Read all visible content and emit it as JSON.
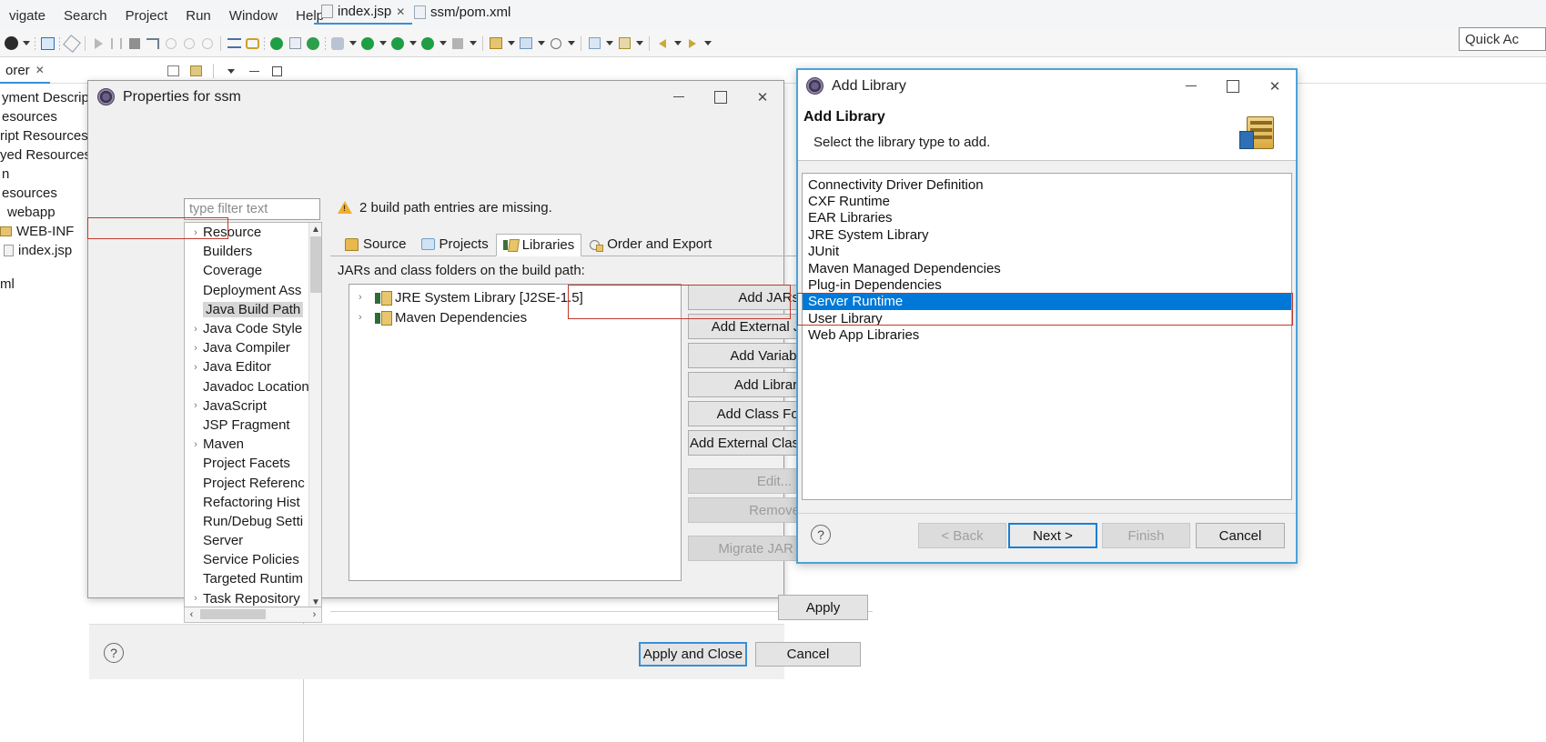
{
  "app": {
    "menu_items": [
      "vigate",
      "Search",
      "Project",
      "Run",
      "Window",
      "Help"
    ],
    "quick_access": {
      "label": "Quick Ac"
    }
  },
  "editor_tabs": [
    {
      "label": "index.jsp",
      "close": "✕",
      "icon": "jsp-file-icon",
      "active": true
    },
    {
      "label": "ssm/pom.xml",
      "close": "",
      "icon": "xml-file-icon",
      "active": false
    }
  ],
  "explorer": {
    "tab_label": "orer",
    "tab_close": "✕",
    "rows": [
      {
        "label": "yment Descrip"
      },
      {
        "label": "esources"
      },
      {
        "label": "ript Resources"
      },
      {
        "label": "yed Resources"
      },
      {
        "label": "n"
      },
      {
        "label": "esources"
      },
      {
        "label": "webapp"
      },
      {
        "label": "WEB-INF"
      },
      {
        "label": "index.jsp"
      },
      {
        "label": "ml"
      }
    ]
  },
  "properties_dialog": {
    "title": "Properties for ssm",
    "icon": "eclipse-icon",
    "window_controls": {
      "minimize": "minimize-icon",
      "maximize": "maximize-icon",
      "close": "✕"
    },
    "filter_placeholder": "type filter text",
    "tree_items": [
      {
        "label": "Resource",
        "expandable": true,
        "selected": false
      },
      {
        "label": "Builders",
        "expandable": false,
        "selected": false
      },
      {
        "label": "Coverage",
        "expandable": false,
        "selected": false
      },
      {
        "label": "Deployment Ass",
        "expandable": false,
        "selected": false
      },
      {
        "label": "Java Build Path",
        "expandable": false,
        "selected": true
      },
      {
        "label": "Java Code Style",
        "expandable": true,
        "selected": false
      },
      {
        "label": "Java Compiler",
        "expandable": true,
        "selected": false
      },
      {
        "label": "Java Editor",
        "expandable": true,
        "selected": false
      },
      {
        "label": "Javadoc Location",
        "expandable": false,
        "selected": false
      },
      {
        "label": "JavaScript",
        "expandable": true,
        "selected": false
      },
      {
        "label": "JSP Fragment",
        "expandable": false,
        "selected": false
      },
      {
        "label": "Maven",
        "expandable": true,
        "selected": false
      },
      {
        "label": "Project Facets",
        "expandable": false,
        "selected": false
      },
      {
        "label": "Project Referenc",
        "expandable": false,
        "selected": false
      },
      {
        "label": "Refactoring Hist",
        "expandable": false,
        "selected": false
      },
      {
        "label": "Run/Debug Setti",
        "expandable": false,
        "selected": false
      },
      {
        "label": "Server",
        "expandable": false,
        "selected": false
      },
      {
        "label": "Service Policies",
        "expandable": false,
        "selected": false
      },
      {
        "label": "Targeted Runtim",
        "expandable": false,
        "selected": false
      },
      {
        "label": "Task Repository",
        "expandable": true,
        "selected": false
      }
    ],
    "message": "2 build path entries are missing.",
    "message_icon": "warning-icon",
    "tabs": [
      {
        "label": "Source",
        "icon": "source-folder-icon",
        "active": false
      },
      {
        "label": "Projects",
        "icon": "projects-icon",
        "active": false
      },
      {
        "label": "Libraries",
        "icon": "libraries-icon",
        "active": true
      },
      {
        "label": "Order and Export",
        "icon": "order-export-icon",
        "active": false
      }
    ],
    "jars_label": "JARs and class folders on the build path:",
    "jar_entries": [
      {
        "label": "JRE System Library [J2SE-1.5]",
        "icon": "jre-library-icon"
      },
      {
        "label": "Maven Dependencies",
        "icon": "jre-library-icon"
      }
    ],
    "side_buttons": [
      {
        "label": "Add JARs...",
        "enabled": true
      },
      {
        "label": "Add External JARs...",
        "enabled": true
      },
      {
        "label": "Add Variable...",
        "enabled": true
      },
      {
        "label": "Add Library...",
        "enabled": true,
        "highlighted": true
      },
      {
        "label": "Add Class Folder...",
        "enabled": true
      },
      {
        "label": "Add External Class Folder...",
        "enabled": true
      },
      {
        "label": "Edit...",
        "enabled": false
      },
      {
        "label": "Remove",
        "enabled": false
      },
      {
        "label": "Migrate JAR File...",
        "enabled": false
      }
    ],
    "apply_label": "Apply",
    "apply_and_close_label": "Apply and Close",
    "cancel_label": "Cancel",
    "help_icon": "help-icon"
  },
  "add_library_dialog": {
    "title": "Add Library",
    "icon": "eclipse-icon",
    "window_controls": {
      "minimize": "minimize-icon",
      "maximize": "maximize-icon",
      "close": "✕"
    },
    "heading": "Add Library",
    "subheading": "Select the library type to add.",
    "banner_icon": "jar-library-banner-icon",
    "library_types": [
      {
        "label": "Connectivity Driver Definition",
        "selected": false
      },
      {
        "label": "CXF Runtime",
        "selected": false
      },
      {
        "label": "EAR Libraries",
        "selected": false
      },
      {
        "label": "JRE System Library",
        "selected": false
      },
      {
        "label": "JUnit",
        "selected": false
      },
      {
        "label": "Maven Managed Dependencies",
        "selected": false
      },
      {
        "label": "Plug-in Dependencies",
        "selected": false
      },
      {
        "label": "Server Runtime",
        "selected": true
      },
      {
        "label": "User Library",
        "selected": false
      },
      {
        "label": "Web App Libraries",
        "selected": false
      }
    ],
    "buttons": {
      "back": {
        "label": "< Back",
        "enabled": false
      },
      "next": {
        "label": "Next >",
        "enabled": true,
        "focused": true
      },
      "finish": {
        "label": "Finish",
        "enabled": false
      },
      "cancel": {
        "label": "Cancel",
        "enabled": true
      }
    },
    "help_icon": "help-icon"
  },
  "annotations": {
    "color": "#c0392b",
    "boxes": [
      "java-build-path-row",
      "add-library-button",
      "server-runtime-row"
    ]
  }
}
